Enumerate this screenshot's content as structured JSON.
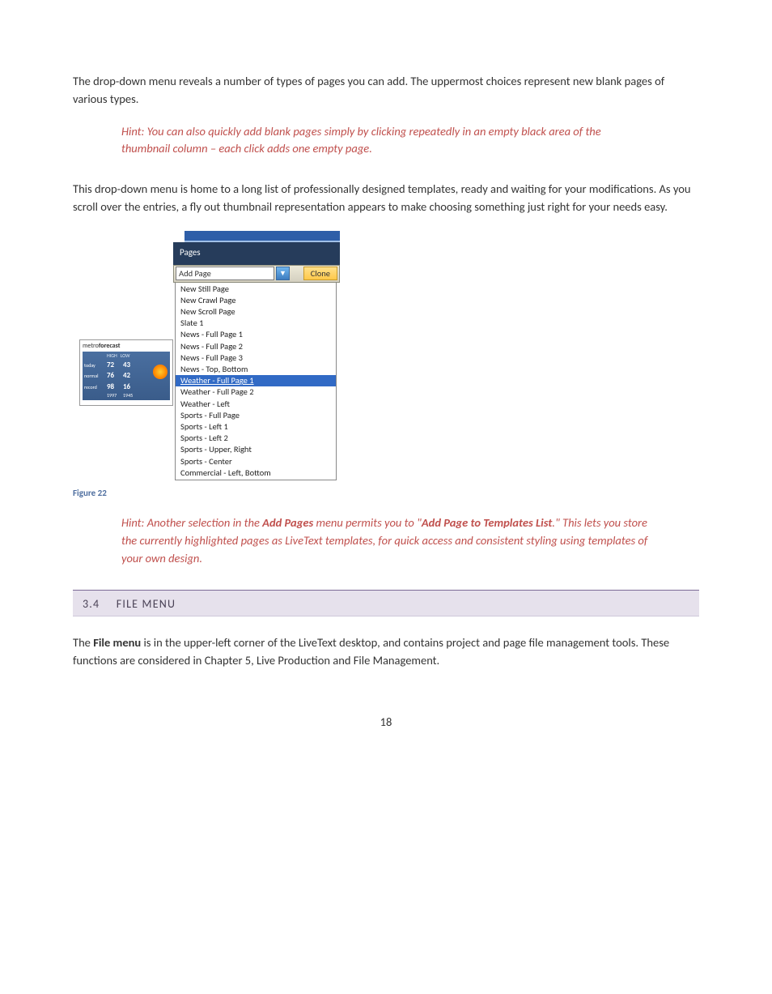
{
  "intro": {
    "p1": "The drop-down menu reveals a number of types of pages you can add.  The uppermost choices represent new blank pages of various types.",
    "hint1": "Hint: You can also quickly add blank pages simply by clicking repeatedly in an empty black area of the thumbnail column – each click adds one empty page.",
    "p2": " This drop-down menu is home to a long list of professionally designed templates, ready and waiting for your modifications. As you scroll over the entries, a fly out thumbnail representation appears to make choosing something just right for your needs easy."
  },
  "screenshot": {
    "pages_label": "Pages",
    "addpage": {
      "label": "Add Page",
      "clone": "Clone"
    },
    "flyout": {
      "metro": "metro",
      "forecast": "forecast",
      "headers": {
        "high": "HIGH",
        "low": "LOW"
      },
      "rows": [
        {
          "lbl": "today",
          "hi": "72",
          "lo": "43"
        },
        {
          "lbl": "normal",
          "hi": "76",
          "lo": "42"
        },
        {
          "lbl": "record",
          "hi": "98",
          "lo": "16"
        },
        {
          "lbl": "",
          "hi": "1997",
          "lo": "1945"
        }
      ]
    },
    "items": [
      "New Still Page",
      "New Crawl Page",
      "New Scroll Page",
      "Slate 1",
      "News - Full Page 1",
      "News - Full Page 2",
      "News - Full Page 3",
      "News - Top, Bottom",
      "Weather - Full Page 1",
      "Weather - Full Page 2",
      "Weather - Left",
      "Sports - Full Page",
      "Sports - Left 1",
      "Sports - Left 2",
      "Sports - Upper, Right",
      "Sports - Center",
      "Commercial - Left, Bottom"
    ],
    "hover_index": 8
  },
  "figcap": "Figure 22",
  "hint2": {
    "pre": "Hint: Another selection in the ",
    "b1": "Add Pages",
    "mid1": " menu permits you to \"",
    "b2": "Add Page to Templates List",
    "mid2": ".\" This lets you store the currently highlighted pages as LiveText templates, for quick access and consistent styling using templates of your own design."
  },
  "section": {
    "num": "3.4",
    "title": "FILE MENU"
  },
  "filemenu_p": {
    "pre": "The ",
    "b": "File menu",
    "post": " is in the upper-left corner of the LiveText desktop, and contains project and page file management tools.  These functions are considered in Chapter 5, Live Production and File Management."
  },
  "pagenum": "18"
}
